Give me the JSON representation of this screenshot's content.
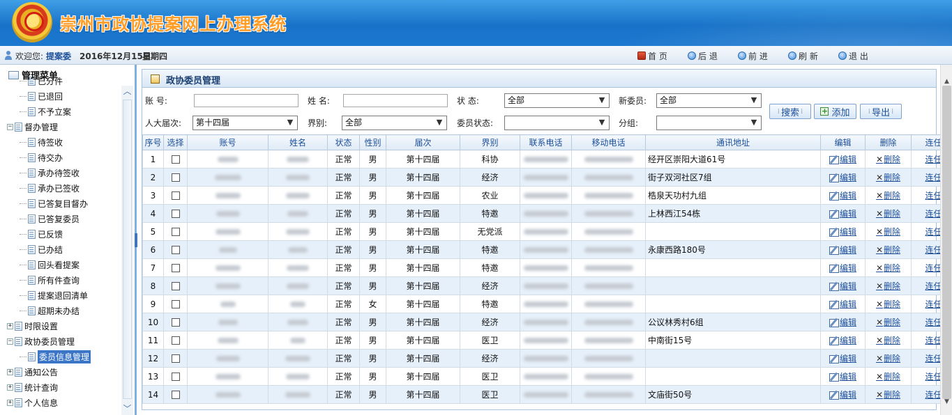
{
  "banner": {
    "title": "崇州市政协提案网上办理系统"
  },
  "infobar": {
    "welcome": "欢迎您:",
    "username": "提案委",
    "date": "2016年12月15日",
    "weekday": "星期四",
    "nav": [
      {
        "label": "首 页",
        "icon": "home-icon"
      },
      {
        "label": "后 退",
        "icon": "back-icon"
      },
      {
        "label": "前 进",
        "icon": "forward-icon"
      },
      {
        "label": "刷 新",
        "icon": "refresh-icon"
      },
      {
        "label": "退 出",
        "icon": "exit-icon"
      }
    ]
  },
  "sidebar": {
    "title": "管理菜单",
    "items": [
      {
        "label": "已分件",
        "level": 2
      },
      {
        "label": "已退回",
        "level": 2
      },
      {
        "label": "不予立案",
        "level": 2
      },
      {
        "label": "督办管理",
        "level": 1,
        "expanded": true
      },
      {
        "label": "待签收",
        "level": 2
      },
      {
        "label": "待交办",
        "level": 2
      },
      {
        "label": "承办待签收",
        "level": 2
      },
      {
        "label": "承办已签收",
        "level": 2
      },
      {
        "label": "已答复目督办",
        "level": 2
      },
      {
        "label": "已答复委员",
        "level": 2
      },
      {
        "label": "已反馈",
        "level": 2
      },
      {
        "label": "已办结",
        "level": 2
      },
      {
        "label": "回头看提案",
        "level": 2
      },
      {
        "label": "所有件查询",
        "level": 2
      },
      {
        "label": "提案退回清单",
        "level": 2
      },
      {
        "label": "超期未办结",
        "level": 2
      },
      {
        "label": "时限设置",
        "level": 1,
        "expanded": false
      },
      {
        "label": "政协委员管理",
        "level": 1,
        "expanded": true
      },
      {
        "label": "委员信息管理",
        "level": 2,
        "selected": true
      },
      {
        "label": "通知公告",
        "level": 1,
        "expanded": false
      },
      {
        "label": "统计查询",
        "level": 1,
        "expanded": false
      },
      {
        "label": "个人信息",
        "level": 1,
        "expanded": false
      }
    ]
  },
  "panel": {
    "title": "政协委员管理"
  },
  "filters": {
    "account_label": "账 号:",
    "account_value": "",
    "name_label": "姓 名:",
    "name_value": "",
    "status_label": "状 态:",
    "status_value": "全部",
    "new_member_label": "新委员:",
    "new_member_value": "全部",
    "session_label": "人大届次:",
    "session_value": "第十四届",
    "sector_label": "界别:",
    "sector_value": "全部",
    "member_status_label": "委员状态:",
    "member_status_value": "",
    "group_label": "分组:",
    "group_value": ""
  },
  "actions": {
    "search": "搜索",
    "add": "添加",
    "export": "导出"
  },
  "table": {
    "headers": [
      "序号",
      "选择",
      "账号",
      "姓名",
      "状态",
      "性别",
      "届次",
      "界别",
      "联系电话",
      "移动电话",
      "通讯地址",
      "编辑",
      "删除",
      "连任"
    ],
    "edit_label": "编辑",
    "delete_label": "删除",
    "reappoint_label": "连任",
    "rows": [
      {
        "no": "1",
        "account": "",
        "name": "",
        "status": "正常",
        "gender": "男",
        "session": "第十四届",
        "sector": "科协",
        "phone": "",
        "mobile": "",
        "address": "经开区崇阳大道61号"
      },
      {
        "no": "2",
        "account": "",
        "name": "",
        "status": "正常",
        "gender": "男",
        "session": "第十四届",
        "sector": "经济",
        "phone": "",
        "mobile": "",
        "address": "街子双河社区7组"
      },
      {
        "no": "3",
        "account": "",
        "name": "",
        "status": "正常",
        "gender": "男",
        "session": "第十四届",
        "sector": "农业",
        "phone": "",
        "mobile": "",
        "address": "梏泉天功村九组"
      },
      {
        "no": "4",
        "account": "",
        "name": "",
        "status": "正常",
        "gender": "男",
        "session": "第十四届",
        "sector": "特邀",
        "phone": "",
        "mobile": "",
        "address": "上林西江54栋"
      },
      {
        "no": "5",
        "account": "",
        "name": "",
        "status": "正常",
        "gender": "男",
        "session": "第十四届",
        "sector": "无党派",
        "phone": "",
        "mobile": "",
        "address": ""
      },
      {
        "no": "6",
        "account": "",
        "name": "",
        "status": "正常",
        "gender": "男",
        "session": "第十四届",
        "sector": "特邀",
        "phone": "",
        "mobile": "",
        "address": "永康西路180号"
      },
      {
        "no": "7",
        "account": "",
        "name": "",
        "status": "正常",
        "gender": "男",
        "session": "第十四届",
        "sector": "特邀",
        "phone": "",
        "mobile": "",
        "address": ""
      },
      {
        "no": "8",
        "account": "",
        "name": "",
        "status": "正常",
        "gender": "男",
        "session": "第十四届",
        "sector": "经济",
        "phone": "",
        "mobile": "",
        "address": ""
      },
      {
        "no": "9",
        "account": "",
        "name": "",
        "status": "正常",
        "gender": "女",
        "session": "第十四届",
        "sector": "特邀",
        "phone": "",
        "mobile": "",
        "address": ""
      },
      {
        "no": "10",
        "account": "",
        "name": "",
        "status": "正常",
        "gender": "男",
        "session": "第十四届",
        "sector": "经济",
        "phone": "",
        "mobile": "",
        "address": "公议林秀村6组"
      },
      {
        "no": "11",
        "account": "",
        "name": "",
        "status": "正常",
        "gender": "男",
        "session": "第十四届",
        "sector": "医卫",
        "phone": "",
        "mobile": "",
        "address": "中南街15号"
      },
      {
        "no": "12",
        "account": "",
        "name": "",
        "status": "正常",
        "gender": "男",
        "session": "第十四届",
        "sector": "经济",
        "phone": "",
        "mobile": "",
        "address": ""
      },
      {
        "no": "13",
        "account": "",
        "name": "",
        "status": "正常",
        "gender": "男",
        "session": "第十四届",
        "sector": "医卫",
        "phone": "",
        "mobile": "",
        "address": ""
      },
      {
        "no": "14",
        "account": "",
        "name": "",
        "status": "正常",
        "gender": "男",
        "session": "第十四届",
        "sector": "医卫",
        "phone": "",
        "mobile": "",
        "address": "文庙街50号"
      }
    ]
  }
}
